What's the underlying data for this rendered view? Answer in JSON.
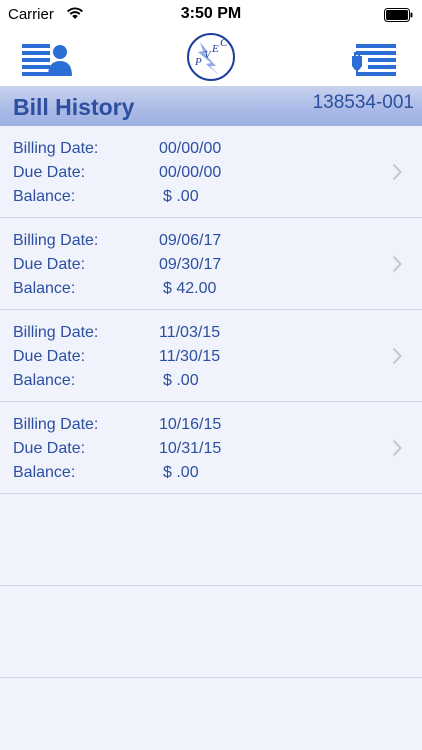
{
  "status_bar": {
    "carrier": "Carrier",
    "time": "3:50 PM"
  },
  "nav": {
    "left_icon": "account-info-icon",
    "logo_text": "PVEC",
    "right_icon": "usage-list-icon"
  },
  "header": {
    "title": "Bill History",
    "account_number": "138534-001"
  },
  "labels": {
    "billing_date": "Billing Date:",
    "due_date": "Due Date:",
    "balance": "Balance:"
  },
  "bills": [
    {
      "billing_date": "00/00/00",
      "due_date": "00/00/00",
      "balance": "$ .00"
    },
    {
      "billing_date": "09/06/17",
      "due_date": "09/30/17",
      "balance": "$ 42.00"
    },
    {
      "billing_date": "11/03/15",
      "due_date": "11/30/15",
      "balance": "$ .00"
    },
    {
      "billing_date": "10/16/15",
      "due_date": "10/31/15",
      "balance": "$ .00"
    }
  ],
  "colors": {
    "accent": "#2c4f9f",
    "icon_blue": "#2b6fd6",
    "list_bg": "#f0f2fc"
  }
}
